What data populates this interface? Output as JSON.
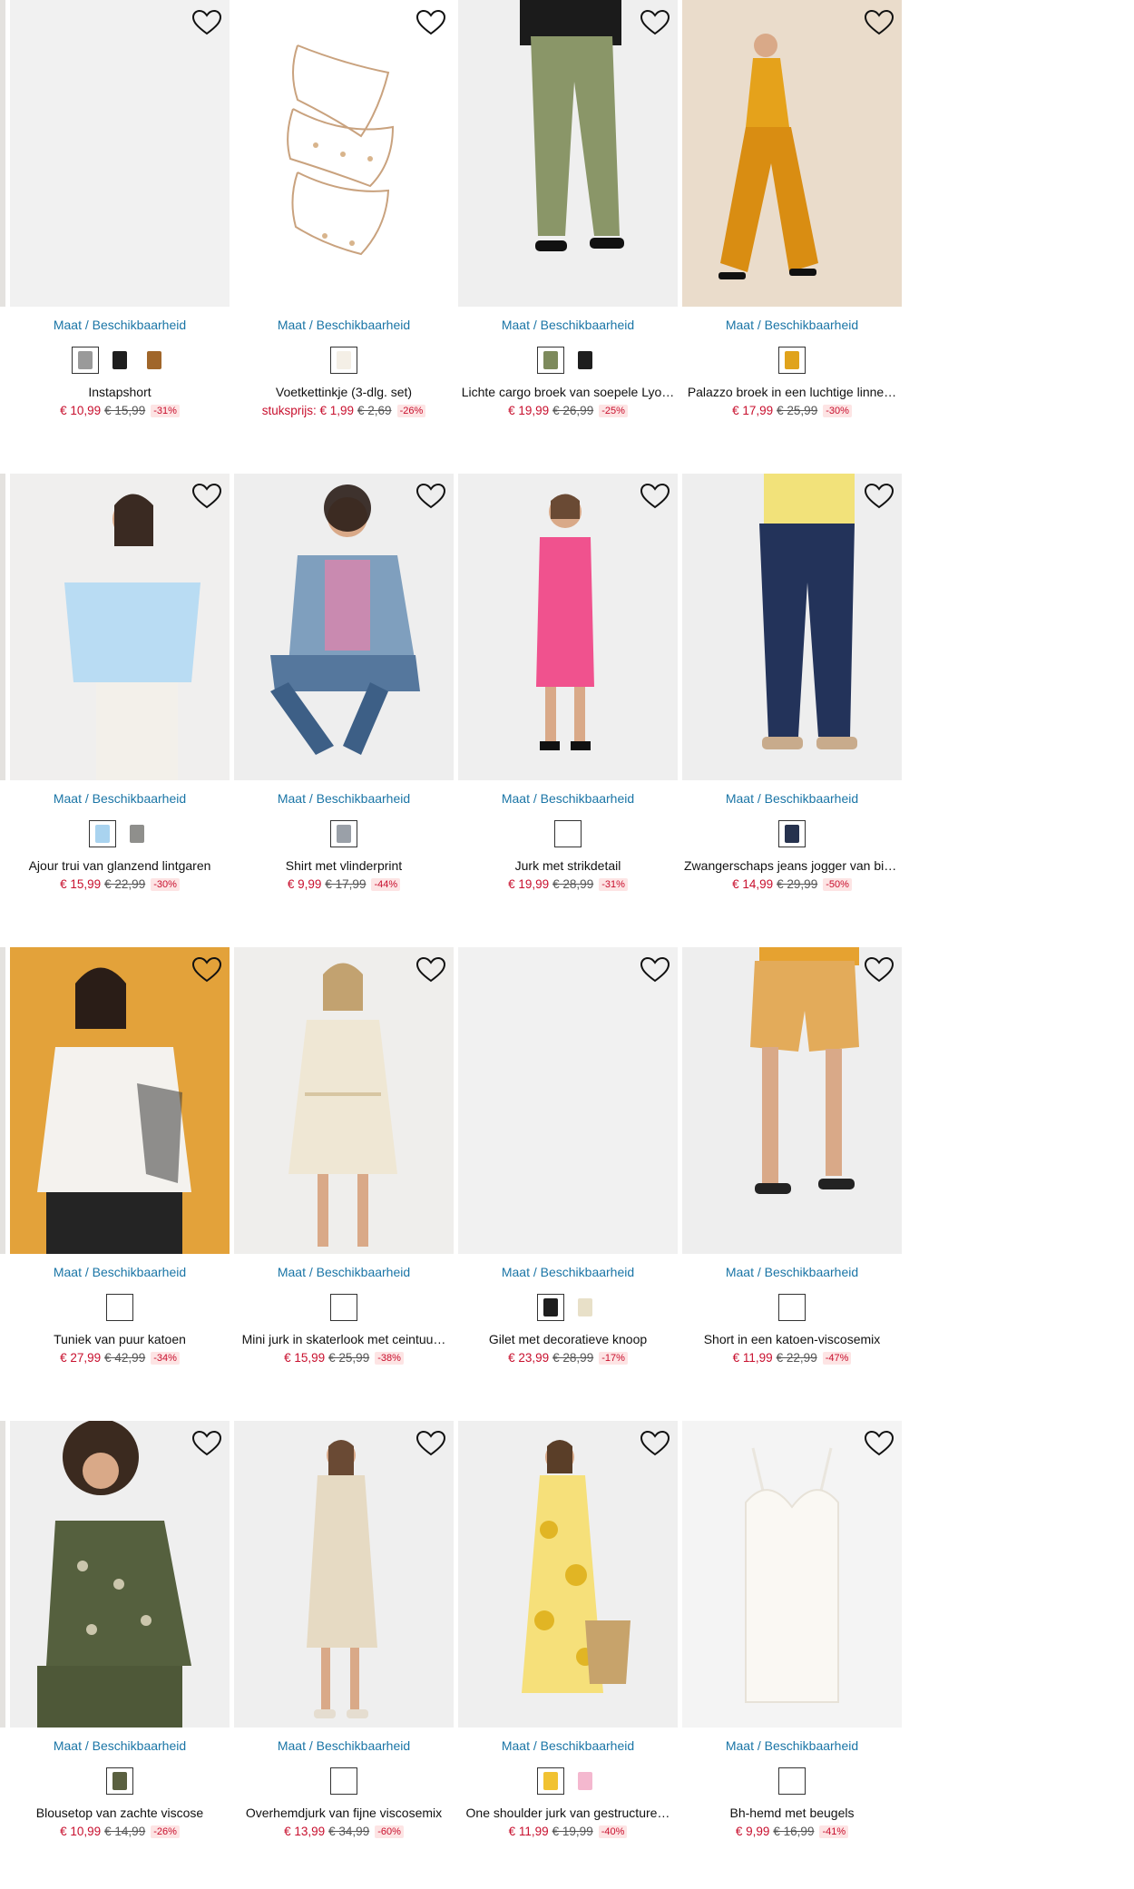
{
  "size_link_label": "Maat / Beschikbaarheid",
  "products": [
    {
      "name": "Instapshort",
      "price": "€ 10,99",
      "old_price": "€ 15,99",
      "discount": "-31%",
      "swatches": [
        "#9a9a9a",
        "#1e1e1e",
        "#a0662a"
      ],
      "selected": 0,
      "bg": "#f1f1f1",
      "figure": "blank"
    },
    {
      "name": "Voetkettinkje (3-dlg. set)",
      "price_prefix": "stuksprijs: ",
      "price": "€ 1,99",
      "old_price": "€ 2,69",
      "discount": "-26%",
      "swatches": [
        "#f4efe6"
      ],
      "selected": 0,
      "bg": "#ffffff",
      "figure": "anklet"
    },
    {
      "name": "Lichte cargo broek van soepele Lyo…",
      "price": "€ 19,99",
      "old_price": "€ 26,99",
      "discount": "-25%",
      "swatches": [
        "#7d8a5c",
        "#1e1e1e"
      ],
      "selected": 0,
      "bg": "#efefef",
      "figure": "pants"
    },
    {
      "name": "Palazzo broek in een luchtige linne…",
      "price": "€ 17,99",
      "old_price": "€ 25,99",
      "discount": "-30%",
      "swatches": [
        "#e0a31c"
      ],
      "selected": 0,
      "bg": "#eadccb",
      "figure": "palazzo"
    },
    {
      "name": "Ajour trui van glanzend lintgaren",
      "price": "€ 15,99",
      "old_price": "€ 22,99",
      "discount": "-30%",
      "swatches": [
        "#a9d3ef",
        "#8f8f8c"
      ],
      "selected": 0,
      "bg": "#f0efee",
      "figure": "knit"
    },
    {
      "name": "Shirt met vlinderprint",
      "price": "€ 9,99",
      "old_price": "€ 17,99",
      "discount": "-44%",
      "swatches": [
        "#9aa0a8"
      ],
      "selected": 0,
      "bg": "#eeeeee",
      "figure": "denim"
    },
    {
      "name": "Jurk met strikdetail",
      "price": "€ 19,99",
      "old_price": "€ 28,99",
      "discount": "-31%",
      "swatches": [],
      "selected": -1,
      "bg": "#efefef",
      "figure": "pinkdress"
    },
    {
      "name": "Zwangerschaps jeans jogger van bio…",
      "price": "€ 14,99",
      "old_price": "€ 29,99",
      "discount": "-50%",
      "swatches": [
        "#26324e"
      ],
      "selected": 0,
      "bg": "#eeeeee",
      "figure": "jeans"
    },
    {
      "name": "Tuniek van puur katoen",
      "price": "€ 27,99",
      "old_price": "€ 42,99",
      "discount": "-34%",
      "swatches": [],
      "selected": -1,
      "bg": "#e3a23a",
      "figure": "tunic"
    },
    {
      "name": "Mini jurk in skaterlook met ceintuu…",
      "price": "€ 15,99",
      "old_price": "€ 25,99",
      "discount": "-38%",
      "swatches": [],
      "selected": -1,
      "bg": "#efeeec",
      "figure": "creamdress"
    },
    {
      "name": "Gilet met decoratieve knoop",
      "price": "€ 23,99",
      "old_price": "€ 28,99",
      "discount": "-17%",
      "swatches": [
        "#1e1e1e",
        "#e8e0c8"
      ],
      "selected": 0,
      "bg": "#f1f1f1",
      "figure": "blank"
    },
    {
      "name": "Short in een katoen-viscosemix",
      "price": "€ 11,99",
      "old_price": "€ 22,99",
      "discount": "-47%",
      "swatches": [],
      "selected": -1,
      "bg": "#eeeeee",
      "figure": "shorts"
    },
    {
      "name": "Blousetop van zachte viscose",
      "price": "€ 10,99",
      "old_price": "€ 14,99",
      "discount": "-26%",
      "swatches": [
        "#5a6040"
      ],
      "selected": 0,
      "bg": "#efefef",
      "figure": "blousetop"
    },
    {
      "name": "Overhemdjurk van fijne viscosemix",
      "price": "€ 13,99",
      "old_price": "€ 34,99",
      "discount": "-60%",
      "swatches": [],
      "selected": -1,
      "bg": "#efefef",
      "figure": "shirtdress"
    },
    {
      "name": "One shoulder jurk van gestructure…",
      "price": "€ 11,99",
      "old_price": "€ 19,99",
      "discount": "-40%",
      "swatches": [
        "#f1c232",
        "#f4b8cf"
      ],
      "selected": 0,
      "bg": "#efefef",
      "figure": "yellowdress"
    },
    {
      "name": "Bh-hemd met beugels",
      "price": "€ 9,99",
      "old_price": "€ 16,99",
      "discount": "-41%",
      "swatches": [],
      "selected": -1,
      "bg": "#f4f4f4",
      "figure": "camisole"
    }
  ]
}
